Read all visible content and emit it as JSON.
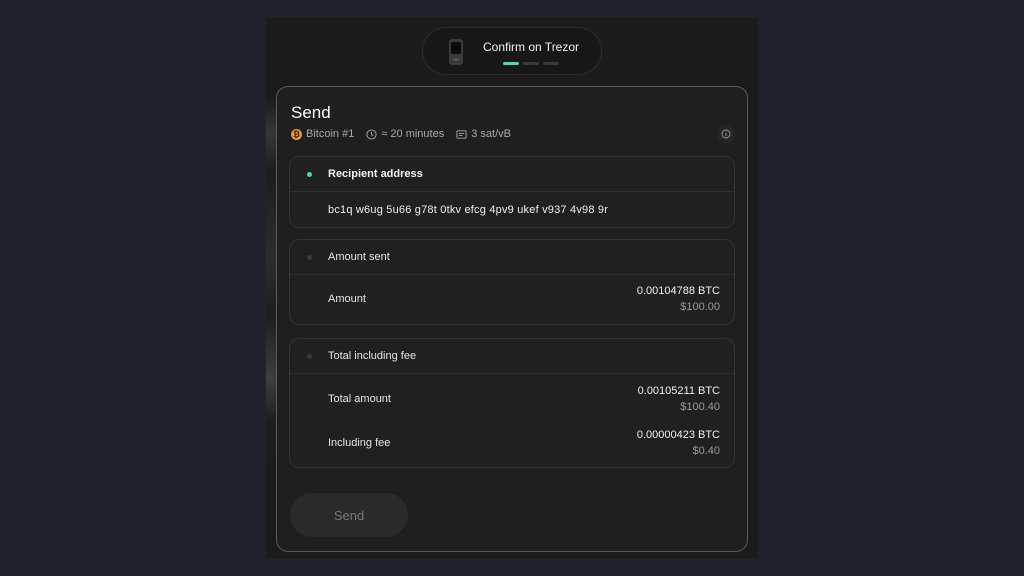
{
  "device_status": {
    "title": "Confirm on Trezor",
    "steps_total": 3,
    "step_active": 1,
    "accent": "#54d6a6"
  },
  "header": {
    "title": "Send",
    "account": "Bitcoin #1",
    "account_icon": "bitcoin-icon",
    "eta": "≈ 20 minutes",
    "fee_rate": "3 sat/vB"
  },
  "recipient": {
    "label": "Recipient address",
    "address": "bc1q w6ug 5u66 g78t 0tkv efcg 4pv9 ukef v937 4v98 9r"
  },
  "amount_sent": {
    "label": "Amount sent",
    "rows": [
      {
        "label": "Amount",
        "crypto": "0.00104788 BTC",
        "fiat": "$100.00"
      }
    ]
  },
  "total": {
    "label": "Total including fee",
    "rows": [
      {
        "label": "Total amount",
        "crypto": "0.00105211 BTC",
        "fiat": "$100.40"
      },
      {
        "label": "Including fee",
        "crypto": "0.00000423 BTC",
        "fiat": "$0.40"
      }
    ]
  },
  "send_button": {
    "label": "Send",
    "disabled": true
  }
}
